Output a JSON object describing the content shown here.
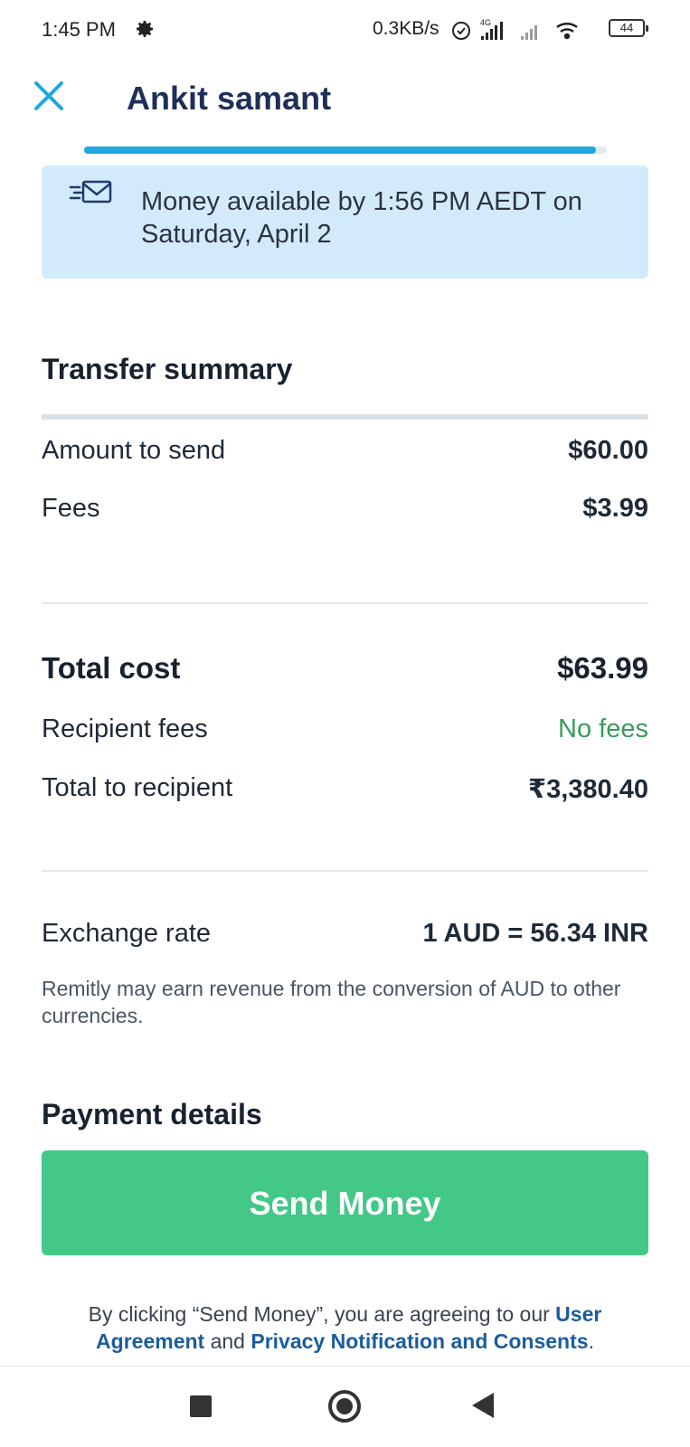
{
  "status_bar": {
    "time": "1:45 PM",
    "speed": "0.3KB/s",
    "network": "4G",
    "battery": "44"
  },
  "header": {
    "title": "Ankit samant",
    "progress_fraction": 0.98,
    "accent_color": "#1ea8de"
  },
  "banner": {
    "icon": "mail-fast-icon",
    "text": "Money available by 1:56 PM AEDT on Saturday, April 2"
  },
  "summary": {
    "title": "Transfer summary",
    "amount_label": "Amount to send",
    "amount_value": "$60.00",
    "fees_label": "Fees",
    "fees_value": "$3.99",
    "total_label": "Total cost",
    "total_value": "$63.99",
    "recipient_fees_label": "Recipient fees",
    "recipient_fees_value": "No fees",
    "recipient_total_label": "Total to recipient",
    "recipient_total_value": "₹3,380.40",
    "rate_label": "Exchange rate",
    "rate_value": "1 AUD = 56.34 INR",
    "disclaimer": "Remitly may earn revenue from the conversion of AUD to other currencies."
  },
  "payment": {
    "title": "Payment details"
  },
  "cta": {
    "label": "Send Money",
    "color": "#43c887"
  },
  "agreement": {
    "prefix": "By clicking “Send Money”, you are agreeing to our ",
    "user_agreement": "User Agreement",
    "middle": " and ",
    "privacy": "Privacy Notification and Consents",
    "suffix": "."
  }
}
